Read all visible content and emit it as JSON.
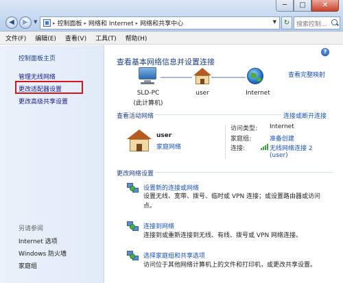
{
  "window": {
    "minimize_glyph": "─",
    "maximize_glyph": "□",
    "close_glyph": "✕"
  },
  "nav": {
    "back_glyph": "◀",
    "forward_glyph": "▶"
  },
  "address": {
    "breadcrumbs": [
      "控制面板",
      "网络和 Internet",
      "网络和共享中心"
    ],
    "separator": "▸"
  },
  "search": {
    "placeholder": "搜索控制..."
  },
  "menu": {
    "items": [
      "文件(F)",
      "编辑(E)",
      "查看(V)",
      "工具(T)",
      "帮助(H)"
    ]
  },
  "sidebar": {
    "home": "控制面板主页",
    "links": [
      "管理无线网络",
      "更改适配器设置",
      "更改高级共享设置"
    ],
    "see_also_title": "另请参阅",
    "see_also": [
      "Internet 选项",
      "Windows 防火墙",
      "家庭组"
    ]
  },
  "main": {
    "help_glyph": "?",
    "title": "查看基本网络信息并设置连接",
    "full_map_link": "查看完整映射",
    "map": {
      "computer_name": "SLD-PC",
      "computer_sub": "(此计算机)",
      "network_name": "user",
      "internet": "Internet"
    },
    "active_section_title": "查看活动网络",
    "connect_disconnect_link": "连接或断开连接",
    "active_network": {
      "name": "user",
      "type": "家庭网络",
      "access_type_label": "访问类型:",
      "access_type_value": "Internet",
      "homegroup_label": "家庭组:",
      "homegroup_value": "准备创建",
      "connections_label": "连接:",
      "connections_value_line1": "无线网络连接 2",
      "connections_value_line2": "(user)"
    },
    "change_section_title": "更改网络设置",
    "tasks": [
      {
        "title": "设置新的连接或网络",
        "desc": "设置无线、宽带、拨号、临时或 VPN 连接；或设置路由器或访问点。"
      },
      {
        "title": "连接到网络",
        "desc": "连接到或重新连接到无线、有线、拨号或 VPN 网络连接。"
      },
      {
        "title": "选择家庭组和共享选项",
        "desc": "访问位于其他网络计算机上的文件和打印机，或更改共享设置。"
      }
    ]
  },
  "colors": {
    "link": "#1a52b8",
    "heading": "#1c3f86",
    "highlight": "#d4141c"
  }
}
